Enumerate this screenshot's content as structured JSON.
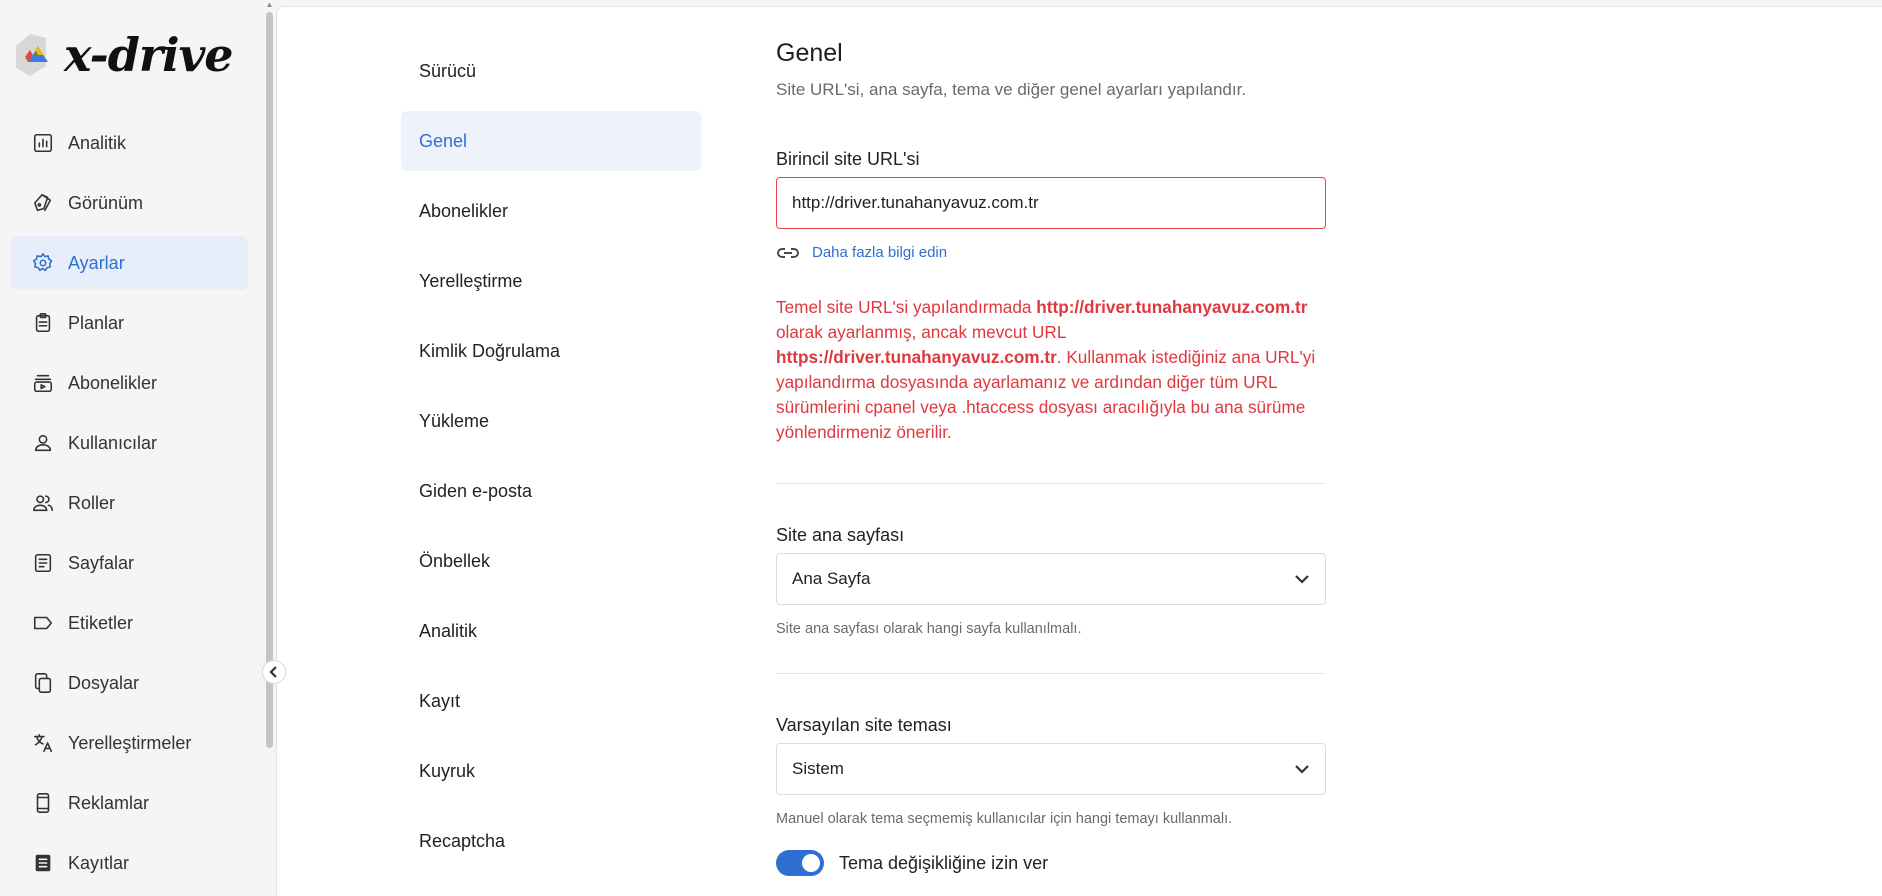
{
  "app": {
    "logo_text": "x-drive"
  },
  "sidebar": {
    "items": [
      {
        "label": "Analitik",
        "icon": "analytics-icon"
      },
      {
        "label": "Görünüm",
        "icon": "appearance-icon"
      },
      {
        "label": "Ayarlar",
        "icon": "gear-icon",
        "active": true
      },
      {
        "label": "Planlar",
        "icon": "clipboard-icon"
      },
      {
        "label": "Abonelikler",
        "icon": "subscriptions-icon"
      },
      {
        "label": "Kullanıcılar",
        "icon": "user-icon"
      },
      {
        "label": "Roller",
        "icon": "people-icon"
      },
      {
        "label": "Sayfalar",
        "icon": "document-icon"
      },
      {
        "label": "Etiketler",
        "icon": "tag-icon"
      },
      {
        "label": "Dosyalar",
        "icon": "files-icon"
      },
      {
        "label": "Yerelleştirmeler",
        "icon": "translate-icon"
      },
      {
        "label": "Reklamlar",
        "icon": "phone-icon"
      },
      {
        "label": "Kayıtlar",
        "icon": "logs-icon"
      }
    ]
  },
  "settings_nav": {
    "items": [
      {
        "label": "Sürücü"
      },
      {
        "label": "Genel",
        "active": true
      },
      {
        "label": "Abonelikler"
      },
      {
        "label": "Yerelleştirme"
      },
      {
        "label": "Kimlik Doğrulama"
      },
      {
        "label": "Yükleme"
      },
      {
        "label": "Giden e-posta"
      },
      {
        "label": "Önbellek"
      },
      {
        "label": "Analitik"
      },
      {
        "label": "Kayıt"
      },
      {
        "label": "Kuyruk"
      },
      {
        "label": "Recaptcha"
      }
    ]
  },
  "general": {
    "title": "Genel",
    "description": "Site URL'si, ana sayfa, tema ve diğer genel ayarları yapılandır.",
    "site_url": {
      "label": "Birincil site URL'si",
      "value": "http://driver.tunahanyavuz.com.tr",
      "learn_more": "Daha fazla bilgi edin"
    },
    "error": {
      "part1": "Temel site URL'si yapılandırmada ",
      "configured_url": "http://driver.tunahanyavuz.com.tr",
      "part2": " olarak ayarlanmış, ancak mevcut URL ",
      "current_url": "https://driver.tunahanyavuz.com.tr",
      "part3": ". Kullanmak istediğiniz ana URL'yi yapılandırma dosyasında ayarlamanız ve ardından diğer tüm URL sürümlerini cpanel veya .htaccess dosyası aracılığıyla bu ana sürüme yönlendirmeniz önerilir."
    },
    "homepage": {
      "label": "Site ana sayfası",
      "value": "Ana Sayfa",
      "hint": "Site ana sayfası olarak hangi sayfa kullanılmalı."
    },
    "theme": {
      "label": "Varsayılan site teması",
      "value": "Sistem",
      "hint": "Manuel olarak tema seçmemiş kullanıcılar için hangi temayı kullanmalı."
    },
    "theme_toggle": {
      "label": "Tema değişikliğine izin ver",
      "on": true
    }
  },
  "colors": {
    "accent": "#2f6fd1",
    "error": "#e0383e",
    "active_bg": "#e7eef9"
  }
}
